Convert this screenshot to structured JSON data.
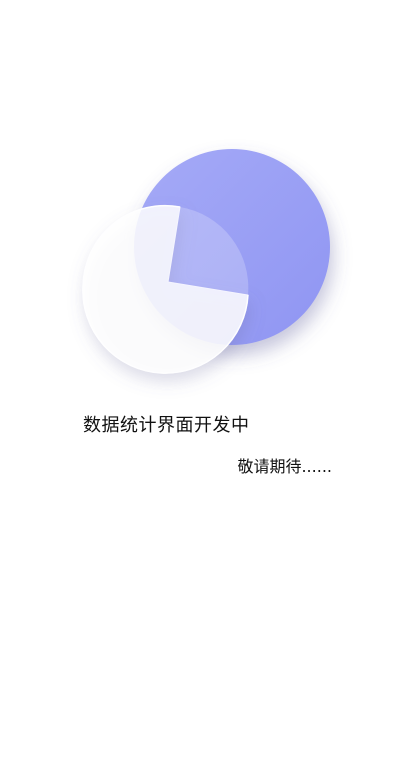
{
  "placeholder": {
    "title": "数据统计界面开发中",
    "subtitle": "敬请期待......"
  },
  "illustration": {
    "icon": "pie-chart-icon",
    "colors": {
      "primary": "#9aa0f5",
      "secondary": "#ffffff",
      "shadow": "#6f6fb8"
    }
  }
}
